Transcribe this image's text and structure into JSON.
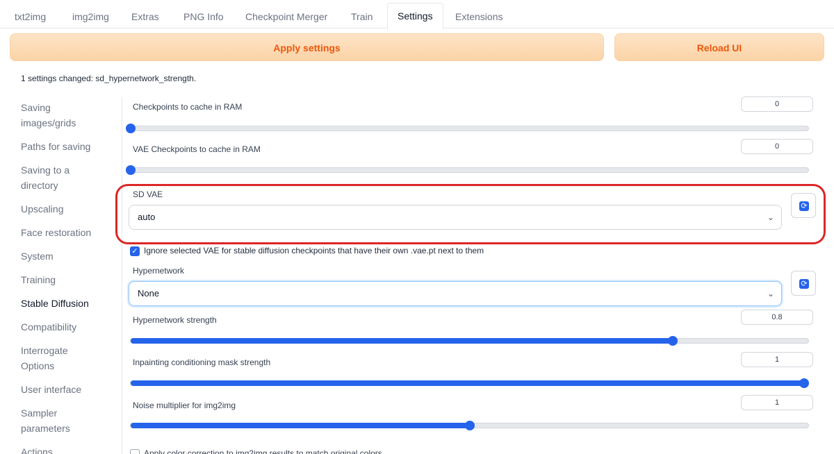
{
  "tabs": [
    "txt2img",
    "img2img",
    "Extras",
    "PNG Info",
    "Checkpoint Merger",
    "Train",
    "Settings",
    "Extensions"
  ],
  "buttons": {
    "apply": "Apply settings",
    "reload": "Reload UI"
  },
  "changed_message": "1 settings changed: sd_hypernetwork_strength.",
  "sidebar": {
    "items": [
      {
        "label": "Saving images/grids"
      },
      {
        "label": "Paths for saving"
      },
      {
        "label": "Saving to a directory"
      },
      {
        "label": "Upscaling"
      },
      {
        "label": "Face restoration"
      },
      {
        "label": "System"
      },
      {
        "label": "Training"
      },
      {
        "label": "Stable Diffusion"
      },
      {
        "label": "Compatibility"
      },
      {
        "label": "Interrogate Options"
      },
      {
        "label": "User interface"
      },
      {
        "label": "Sampler parameters"
      },
      {
        "label": "Actions"
      }
    ],
    "active": "Stable Diffusion"
  },
  "settings": {
    "ckpt_cache": {
      "label": "Checkpoints to cache in RAM",
      "value": "0",
      "fraction": 0
    },
    "vae_cache": {
      "label": "VAE Checkpoints to cache in RAM",
      "value": "0",
      "fraction": 0
    },
    "sd_vae": {
      "label": "SD VAE",
      "value": "auto"
    },
    "ignore_vae": {
      "label": "Ignore selected VAE for stable diffusion checkpoints that have their own .vae.pt next to them",
      "checked": true
    },
    "hypernetwork": {
      "label": "Hypernetwork",
      "value": "None"
    },
    "hn_strength": {
      "label": "Hypernetwork strength",
      "value": "0.8",
      "fraction": 0.8
    },
    "inpaint_mask": {
      "label": "Inpainting conditioning mask strength",
      "value": "1",
      "fraction": 1.0
    },
    "noise_mult": {
      "label": "Noise multiplier for img2img",
      "value": "1",
      "fraction": 0.5
    },
    "apply_color_correction": {
      "label": "Apply color correction to img2img results to match original colors.",
      "checked": false
    }
  },
  "colors": {
    "accent": "#2563eb",
    "button_text": "#ea580c",
    "highlight": "#dc2626"
  },
  "icons": {
    "refresh": "refresh-icon",
    "chevron": "chevron-down-icon",
    "check": "check-icon"
  }
}
